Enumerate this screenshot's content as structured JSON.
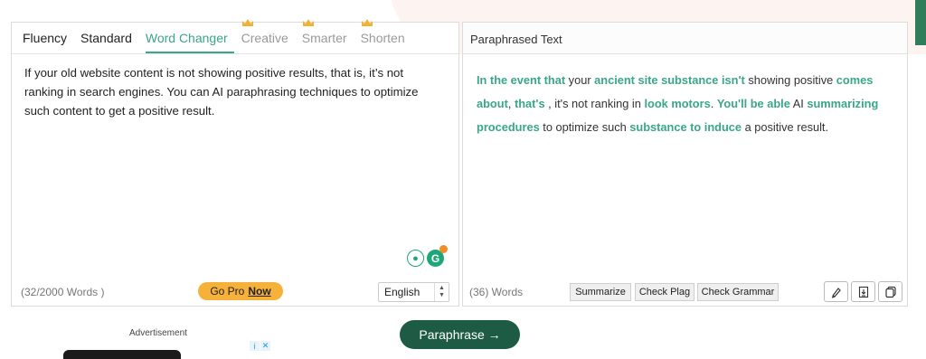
{
  "left_panel": {
    "tabs": [
      {
        "label": "Fluency",
        "state": "normal"
      },
      {
        "label": "Standard",
        "state": "normal"
      },
      {
        "label": "Word Changer",
        "state": "active"
      },
      {
        "label": "Creative",
        "state": "premium"
      },
      {
        "label": "Smarter",
        "state": "premium"
      },
      {
        "label": "Shorten",
        "state": "premium"
      }
    ],
    "input_text": "If your old website content is not showing positive results, that is, it’s not ranking in search engines. You can AI paraphrasing techniques to optimize such content to get a positive result.",
    "word_count": "(32/2000 Words )",
    "gopro": {
      "prefix": "Go Pro",
      "link": "Now"
    },
    "language": "English"
  },
  "right_panel": {
    "header": "Paraphrased Text",
    "output_segments": [
      {
        "text": "In the event that",
        "hl": true
      },
      {
        "text": " your ",
        "hl": false
      },
      {
        "text": "ancient site substance isn't",
        "hl": true
      },
      {
        "text": " showing positive ",
        "hl": false
      },
      {
        "text": "comes about",
        "hl": true
      },
      {
        "text": ", ",
        "hl": false
      },
      {
        "text": "that's",
        "hl": true
      },
      {
        "text": " , it's not ranking in ",
        "hl": false
      },
      {
        "text": "look motors",
        "hl": true
      },
      {
        "text": ". ",
        "hl": false
      },
      {
        "text": "You'll be able",
        "hl": true
      },
      {
        "text": " AI ",
        "hl": false
      },
      {
        "text": "summarizing procedures",
        "hl": true
      },
      {
        "text": " to optimize such ",
        "hl": false
      },
      {
        "text": "substance to induce",
        "hl": true
      },
      {
        "text": " a positive result.",
        "hl": false
      }
    ],
    "word_count": "(36) Words",
    "buttons": {
      "summarize": "Summarize",
      "check_plag": "Check Plag",
      "check_grammar": "Check Grammar"
    },
    "icons": [
      "highlighter-icon",
      "download-icon",
      "copy-icon"
    ]
  },
  "paraphrase_button": "Paraphrase →",
  "advertisement_label": "Advertisement",
  "colors": {
    "accent": "#3aa68a",
    "primary_button": "#1e5b45",
    "gopro": "#f6b13a"
  }
}
